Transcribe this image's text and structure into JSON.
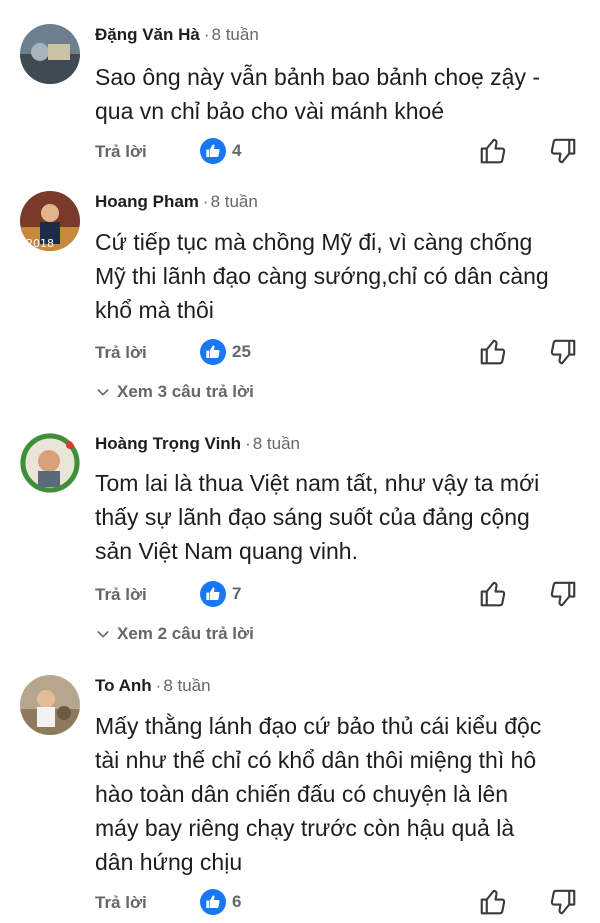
{
  "comments": [
    {
      "author": "Đặng Văn Hà",
      "time": "8 tuần",
      "lines": [
        "Sao ông này vẫn bảnh bao bảnh choẹ zậy -",
        "qua vn chỉ bảo cho vài mánh khoé"
      ],
      "reply_label": "Trả lời",
      "likes": "4",
      "view_replies": ""
    },
    {
      "author": "Hoang Pham",
      "time": "8 tuần",
      "lines": [
        "Cứ tiếp tục mà chồng Mỹ đi, vì càng chống",
        "Mỹ thi lãnh đạo càng sướng,chỉ có dân càng",
        "khổ mà thôi"
      ],
      "reply_label": "Trả lời",
      "likes": "25",
      "view_replies": "Xem 3 câu trả lời"
    },
    {
      "author": "Hoàng Trọng Vinh",
      "time": "8 tuần",
      "lines": [
        "Tom lai là thua Việt nam tất,  như vậy ta mới",
        "thấy sự lãnh đạo sáng suốt của đảng cộng",
        "sản Việt Nam quang vinh."
      ],
      "reply_label": "Trả lời",
      "likes": "7",
      "view_replies": "Xem 2 câu trả lời"
    },
    {
      "author": "To Anh",
      "time": "8 tuần",
      "lines": [
        "Mấy thằng lánh đạo cứ bảo thủ cái kiểu độc",
        "tài như thế chỉ có khổ dân thôi miệng thì hô",
        "hào toàn dân chiến đấu có chuyện là lên",
        "máy bay riêng chạy trước còn hậu quả là",
        "dân hứng chịu"
      ],
      "reply_label": "Trả lời",
      "likes": "6",
      "view_replies": ""
    }
  ],
  "colors": {
    "accent": "#1877f2",
    "muted": "#65676b",
    "text": "#1c1e21"
  },
  "icons": {
    "like_badge": "thumbs-up-badge-icon",
    "like": "thumb-up-icon",
    "dislike": "thumb-down-icon",
    "expand": "chevron-down-icon"
  }
}
